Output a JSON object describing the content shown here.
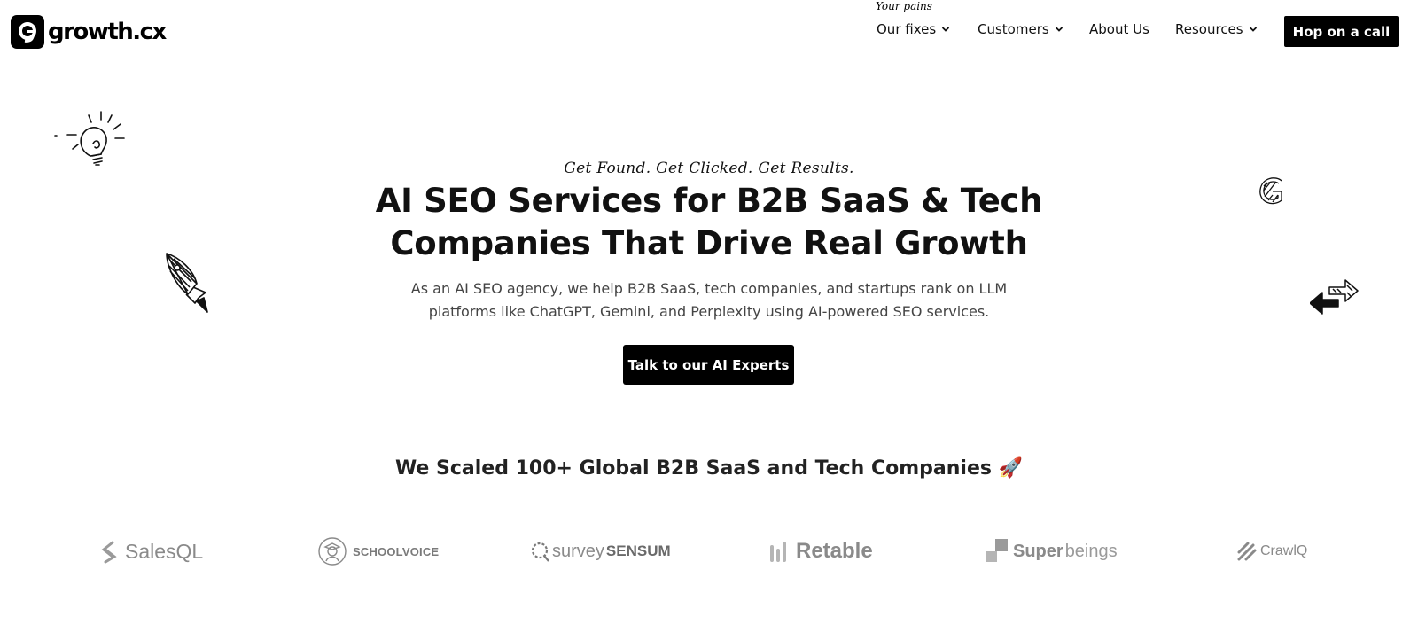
{
  "brand": {
    "name": "growth.cx",
    "logo_icon": "g-logo-icon"
  },
  "nav": {
    "note": "Your pains",
    "items": [
      {
        "label": "Our fixes",
        "has_dropdown": true
      },
      {
        "label": "Customers",
        "has_dropdown": true
      },
      {
        "label": "About Us",
        "has_dropdown": false
      },
      {
        "label": "Resources",
        "has_dropdown": true
      }
    ],
    "cta": "Hop on a call"
  },
  "hero": {
    "tagline": "Get Found. Get Clicked. Get Results.",
    "title_line1": "AI SEO Services for B2B SaaS & Tech",
    "title_line2": "Companies That Drive Real Growth",
    "subtitle_line1": "As an AI SEO agency, we help B2B SaaS, tech companies, and startups rank on LLM",
    "subtitle_line2": "platforms like ChatGPT, Gemini, and Perplexity using AI-powered SEO services.",
    "cta": "Talk to our AI Experts"
  },
  "social_proof": {
    "heading": "We Scaled 100+ Global B2B SaaS and Tech Companies",
    "emoji": "🚀",
    "clients": [
      {
        "name": "SalesQL",
        "icon": "salesql-logo-icon"
      },
      {
        "name": "SCHOOLVOICE",
        "icon": "schoolvoice-logo-icon"
      },
      {
        "name_part1": "survey",
        "name_part2": "SENSUM",
        "icon": "surveysensum-logo-icon"
      },
      {
        "name": "Retable",
        "icon": "retable-logo-icon"
      },
      {
        "name_part1": "Super",
        "name_part2": "beings",
        "icon": "superbeings-logo-icon"
      },
      {
        "name": "CrawlQ",
        "icon": "crawlq-logo-icon"
      }
    ]
  },
  "doodles": [
    "lightbulb-icon",
    "rocket-icon",
    "g-letter-icon",
    "arrows-icon"
  ],
  "colors": {
    "primary": "#000000",
    "text": "#111111",
    "muted": "#444444",
    "logo_gray": "#8a8a8a"
  }
}
